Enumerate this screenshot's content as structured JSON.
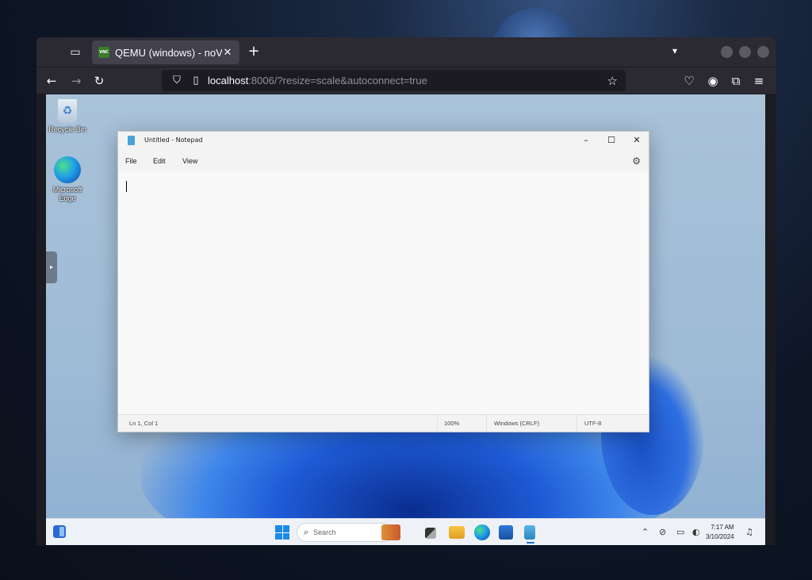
{
  "browser": {
    "tab": {
      "title": "QEMU (windows) - noVNC",
      "favicon_text": "VNC",
      "close": "✕"
    },
    "new_tab": "+",
    "url": {
      "host": "localhost",
      "rest": ":8006/?resize=scale&autoconnect=true"
    }
  },
  "desktop": {
    "icons": [
      {
        "label": "Recycle Bin"
      },
      {
        "label": "Microsoft Edge"
      }
    ]
  },
  "notepad": {
    "title": "Untitled - Notepad",
    "menu": [
      "File",
      "Edit",
      "View"
    ],
    "controls": {
      "minimize": "–",
      "maximize": "☐",
      "close": "✕"
    },
    "status": {
      "position": "Ln 1, Col 1",
      "zoom": "100%",
      "line_ending": "Windows (CRLF)",
      "encoding": "UTF-8"
    }
  },
  "taskbar": {
    "search_placeholder": "Search",
    "clock": {
      "time": "7:17 AM",
      "date": "3/10/2024"
    },
    "apps": [
      "start",
      "search",
      "file-explorer",
      "edge",
      "store",
      "notepad"
    ]
  },
  "colors": {
    "accent": "#1a6ad6",
    "browser_bg": "#2b2a33",
    "notepad_bg": "#f9f9f9"
  }
}
